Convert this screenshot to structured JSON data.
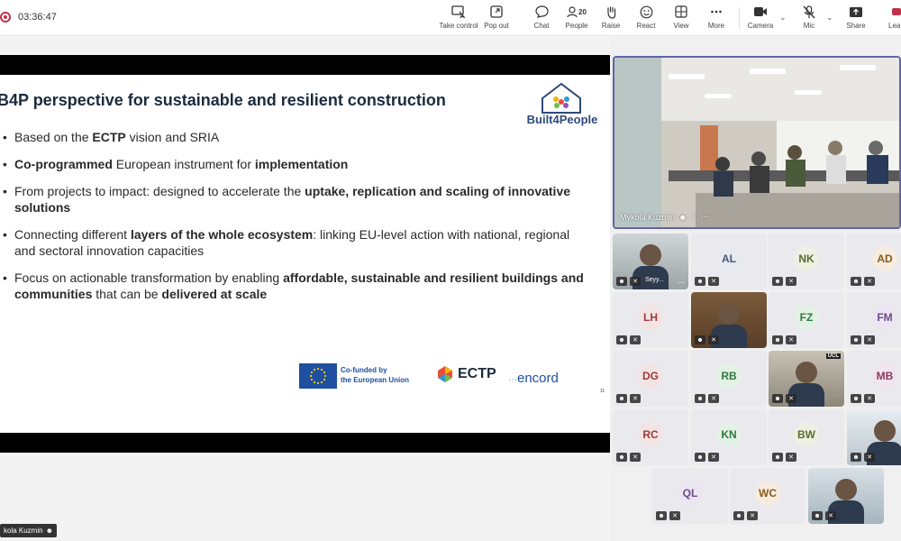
{
  "meeting": {
    "timer": "03:36:47",
    "toolbar": {
      "take_control": "Take control",
      "pop_out": "Pop out",
      "chat": "Chat",
      "people": "People",
      "people_count": "20",
      "raise": "Raise",
      "react": "React",
      "view": "View",
      "more": "More",
      "camera": "Camera",
      "mic": "Mic",
      "share": "Share",
      "leave": "Lea"
    }
  },
  "slide": {
    "title": "B4P perspective for sustainable and resilient construction",
    "logo_text": "Built4People",
    "bullets": [
      [
        {
          "t": "Based on the "
        },
        {
          "t": "ECTP",
          "b": true
        },
        {
          "t": " vision and SRIA"
        }
      ],
      [
        {
          "t": "Co-programmed",
          "b": true
        },
        {
          "t": " European instrument for "
        },
        {
          "t": "implementation",
          "b": true
        }
      ],
      [
        {
          "t": "From projects to impact: designed to accelerate the "
        },
        {
          "t": "uptake, replication and scaling of innovative solutions",
          "b": true
        }
      ],
      [
        {
          "t": "Connecting different "
        },
        {
          "t": "layers of the whole ecosystem",
          "b": true
        },
        {
          "t": ": linking EU-level action with national, regional and sectoral innovation capacities"
        }
      ],
      [
        {
          "t": "Focus on actionable transformation by enabling "
        },
        {
          "t": "affordable, sustainable and resilient buildings and communities",
          "b": true
        },
        {
          "t": " that can be "
        },
        {
          "t": "delivered at scale",
          "b": true
        }
      ]
    ],
    "eu_line1": "Co-funded by",
    "eu_line2": "the European Union",
    "ectp": "ECTP",
    "encord": "encord",
    "page_number": "11"
  },
  "presenter_tag": "kola Kuzmin",
  "main_video": {
    "name": "Mykola Kuzmin"
  },
  "participants": [
    {
      "id": "seyy",
      "name": "Seyy...",
      "initials": "",
      "video": true
    },
    {
      "id": "al",
      "initials": "AL",
      "bg": "#e8eaf2",
      "fg": "#4a5578"
    },
    {
      "id": "nk",
      "initials": "NK",
      "bg": "#eef0e4",
      "fg": "#5b6b2e"
    },
    {
      "id": "ad",
      "initials": "AD",
      "bg": "#f6ece0",
      "fg": "#8a5a1c"
    },
    {
      "id": "lh",
      "initials": "LH",
      "bg": "#f3e4e4",
      "fg": "#9a3a3a"
    },
    {
      "id": "v1",
      "initials": "",
      "video": true
    },
    {
      "id": "fz",
      "initials": "FZ",
      "bg": "#e4f1e6",
      "fg": "#2f7a3f"
    },
    {
      "id": "fm",
      "initials": "FM",
      "bg": "#ece6f2",
      "fg": "#6a4a8a"
    },
    {
      "id": "dg",
      "initials": "DG",
      "bg": "#f3e4e4",
      "fg": "#9a3a3a"
    },
    {
      "id": "rb",
      "initials": "RB",
      "bg": "#e4f1e6",
      "fg": "#2f7a3f"
    },
    {
      "id": "ucl",
      "initials": "",
      "video": true,
      "badge": "UCL"
    },
    {
      "id": "mb",
      "initials": "MB",
      "bg": "#f2e4ec",
      "fg": "#8a3a62"
    },
    {
      "id": "rc",
      "initials": "RC",
      "bg": "#f3e4e4",
      "fg": "#9a3a3a"
    },
    {
      "id": "kn",
      "initials": "KN",
      "bg": "#e4f1e6",
      "fg": "#2f7a3f"
    },
    {
      "id": "bw",
      "initials": "BW",
      "bg": "#eef0e4",
      "fg": "#5b6b2e"
    },
    {
      "id": "v3",
      "initials": "",
      "video": true
    },
    {
      "id": "ql",
      "initials": "QL",
      "bg": "#ece6f2",
      "fg": "#6a4a8a"
    },
    {
      "id": "wc",
      "initials": "WC",
      "bg": "#f6ece0",
      "fg": "#8a5a1c"
    },
    {
      "id": "v4",
      "initials": "",
      "video": true
    }
  ]
}
